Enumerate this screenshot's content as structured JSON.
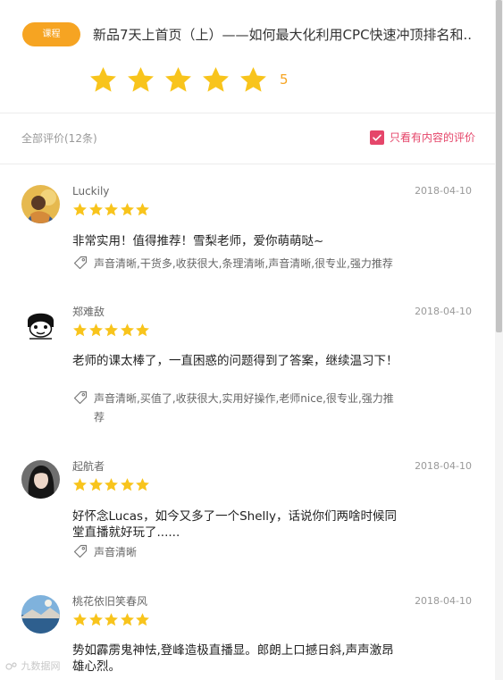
{
  "header": {
    "badge_label": "课程",
    "course_title": "新品7天上首页（上）——如何最大化利用CPC快速冲顶排名和...",
    "rating_stars": 5,
    "rating_score": "5"
  },
  "filter": {
    "review_count": "全部评价(12条)",
    "content_only_label": "只看有内容的评价",
    "content_only_checked": true
  },
  "reviews": [
    {
      "username": "Luckily",
      "date": "2018-04-10",
      "stars": 5,
      "text": "非常实用！值得推荐！雪梨老师，爱你萌萌哒~",
      "tags": "声音清晰,干货多,收获很大,条理清晰,声音清晰,很专业,强力推荐"
    },
    {
      "username": "郑难敌",
      "date": "2018-04-10",
      "stars": 5,
      "text": "老师的课太棒了，一直困惑的问题得到了答案，继续温习下！",
      "tags": "声音清晰,买值了,收获很大,实用好操作,老师nice,很专业,强力推荐"
    },
    {
      "username": "起航者",
      "date": "2018-04-10",
      "stars": 5,
      "text": "好怀念Lucas，如今又多了一个Shelly，话说你们两啥时候同堂直播就好玩了......",
      "tags": "声音清晰"
    },
    {
      "username": "桃花依旧笑春风",
      "date": "2018-04-10",
      "stars": 5,
      "text": "势如霹雳鬼神怯,登峰造极直播显。郎朗上口撼日斜,声声激昂雄心烈。",
      "tags": ""
    }
  ],
  "watermark": "九数据网",
  "colors": {
    "accent_orange": "#f6a422",
    "star_yellow": "#f8c41c",
    "filter_pink": "#e5466a"
  }
}
